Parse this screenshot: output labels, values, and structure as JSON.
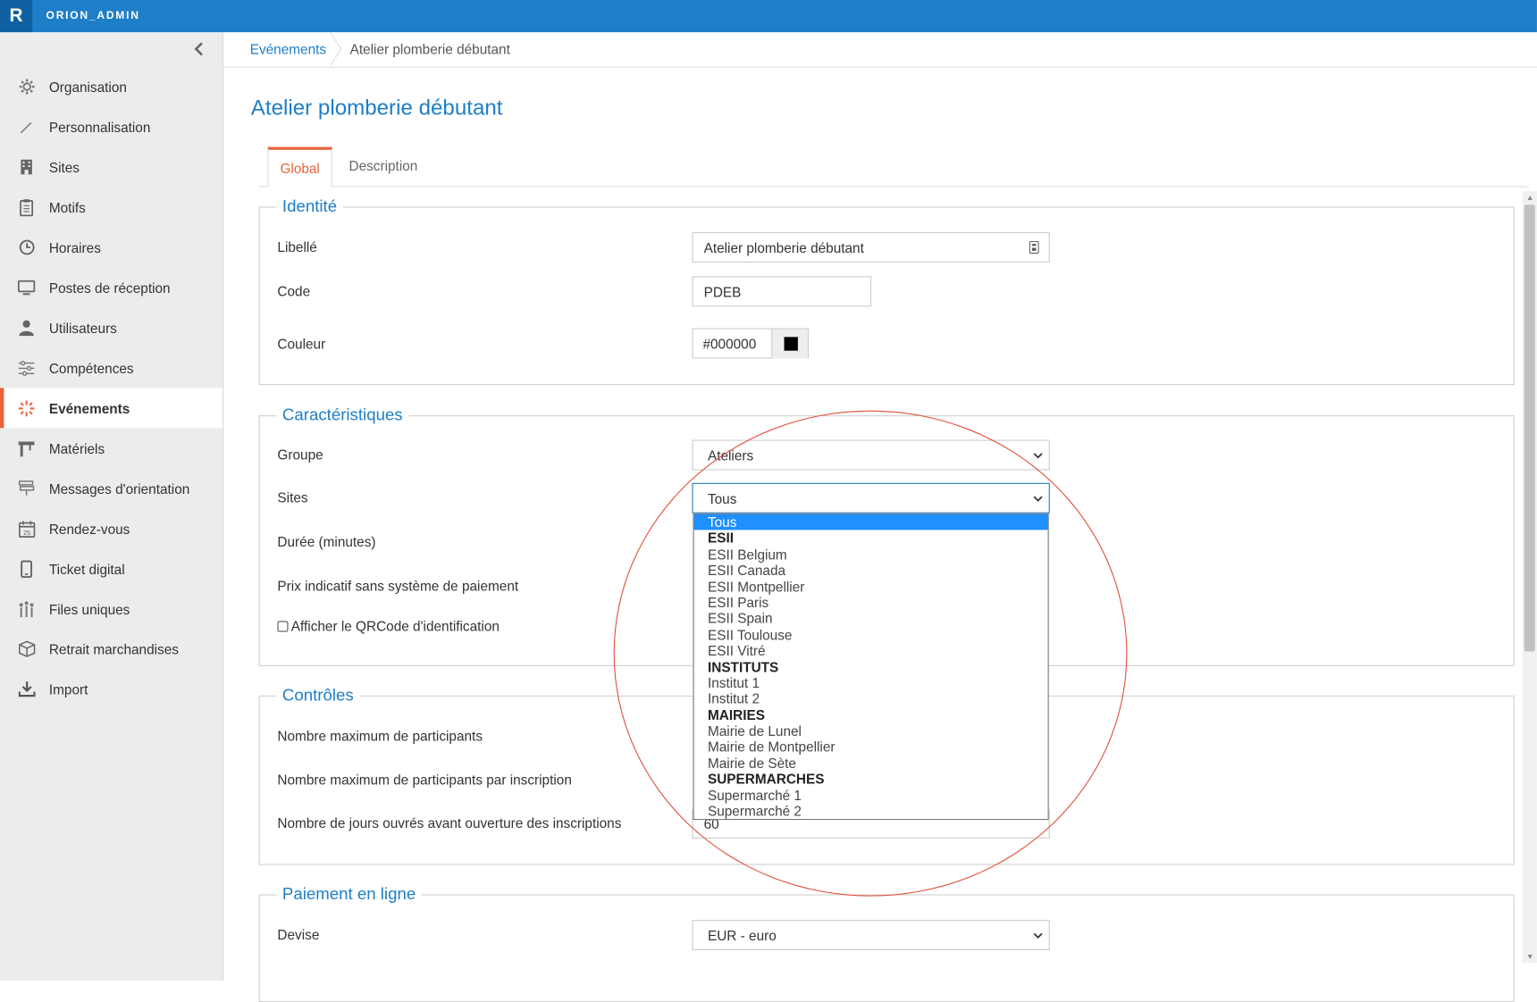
{
  "app": {
    "logo": "R",
    "title": "ORION_ADMIN"
  },
  "sidebar": {
    "collapse_icon": "chevron-left-icon",
    "items": [
      {
        "label": "Organisation",
        "icon": "gear-icon",
        "active": false
      },
      {
        "label": "Personnalisation",
        "icon": "brush-icon",
        "active": false
      },
      {
        "label": "Sites",
        "icon": "building-icon",
        "active": false
      },
      {
        "label": "Motifs",
        "icon": "clipboard-icon",
        "active": false
      },
      {
        "label": "Horaires",
        "icon": "clock-icon",
        "active": false
      },
      {
        "label": "Postes de réception",
        "icon": "monitor-icon",
        "active": false
      },
      {
        "label": "Utilisateurs",
        "icon": "user-icon",
        "active": false
      },
      {
        "label": "Compétences",
        "icon": "sliders-icon",
        "active": false
      },
      {
        "label": "Evénements",
        "icon": "sparkle-icon",
        "active": true
      },
      {
        "label": "Matériels",
        "icon": "tools-icon",
        "active": false
      },
      {
        "label": "Messages d'orientation",
        "icon": "signpost-icon",
        "active": false
      },
      {
        "label": "Rendez-vous",
        "icon": "calendar-icon",
        "active": false
      },
      {
        "label": "Ticket digital",
        "icon": "phone-icon",
        "active": false
      },
      {
        "label": "Files uniques",
        "icon": "queue-icon",
        "active": false
      },
      {
        "label": "Retrait marchandises",
        "icon": "box-icon",
        "active": false
      },
      {
        "label": "Import",
        "icon": "download-icon",
        "active": false
      }
    ]
  },
  "breadcrumb": {
    "parent": "Evénements",
    "current": "Atelier plomberie débutant"
  },
  "page_title": "Atelier plomberie débutant",
  "tabs": [
    {
      "label": "Global",
      "active": true
    },
    {
      "label": "Description",
      "active": false
    }
  ],
  "identite": {
    "legend": "Identité",
    "libelle_label": "Libellé",
    "libelle_value": "Atelier plomberie débutant",
    "code_label": "Code",
    "code_value": "PDEB",
    "couleur_label": "Couleur",
    "couleur_value": "#000000"
  },
  "caracteristiques": {
    "legend": "Caractéristiques",
    "groupe_label": "Groupe",
    "groupe_value": "Ateliers",
    "sites_label": "Sites",
    "sites_value": "Tous",
    "duree_label": "Durée (minutes)",
    "prix_label": "Prix indicatif sans système de paiement",
    "qrcode_label": "Afficher le QRCode d'identification"
  },
  "controles": {
    "legend": "Contrôles",
    "max_participants_label": "Nombre maximum de participants",
    "max_par_inscription_label": "Nombre maximum de participants par inscription",
    "jours_ouvres_label": "Nombre de jours ouvrés avant ouverture des inscriptions",
    "jours_ouvres_value": "60"
  },
  "paiement": {
    "legend": "Paiement en ligne",
    "devise_label": "Devise",
    "devise_value": "EUR - euro"
  },
  "sites_dropdown": [
    {
      "label": "Tous",
      "type": "selected"
    },
    {
      "label": "ESII",
      "type": "group"
    },
    {
      "label": "ESII Belgium",
      "type": "option"
    },
    {
      "label": "ESII Canada",
      "type": "option"
    },
    {
      "label": "ESII Montpellier",
      "type": "option"
    },
    {
      "label": "ESII Paris",
      "type": "option"
    },
    {
      "label": "ESII Spain",
      "type": "option"
    },
    {
      "label": "ESII Toulouse",
      "type": "option"
    },
    {
      "label": "ESII Vitré",
      "type": "option"
    },
    {
      "label": "INSTITUTS",
      "type": "group"
    },
    {
      "label": "Institut 1",
      "type": "option"
    },
    {
      "label": "Institut 2",
      "type": "option"
    },
    {
      "label": "MAIRIES",
      "type": "group"
    },
    {
      "label": "Mairie de Lunel",
      "type": "option"
    },
    {
      "label": "Mairie de Montpellier",
      "type": "option"
    },
    {
      "label": "Mairie de Sète",
      "type": "option"
    },
    {
      "label": "SUPERMARCHES",
      "type": "group"
    },
    {
      "label": "Supermarché 1",
      "type": "option"
    },
    {
      "label": "Supermarché 2",
      "type": "option"
    }
  ],
  "colors": {
    "brand": "#1e7ec8",
    "accent": "#e8643c",
    "highlight": "#1e90ff",
    "annotation": "#e0503a"
  }
}
